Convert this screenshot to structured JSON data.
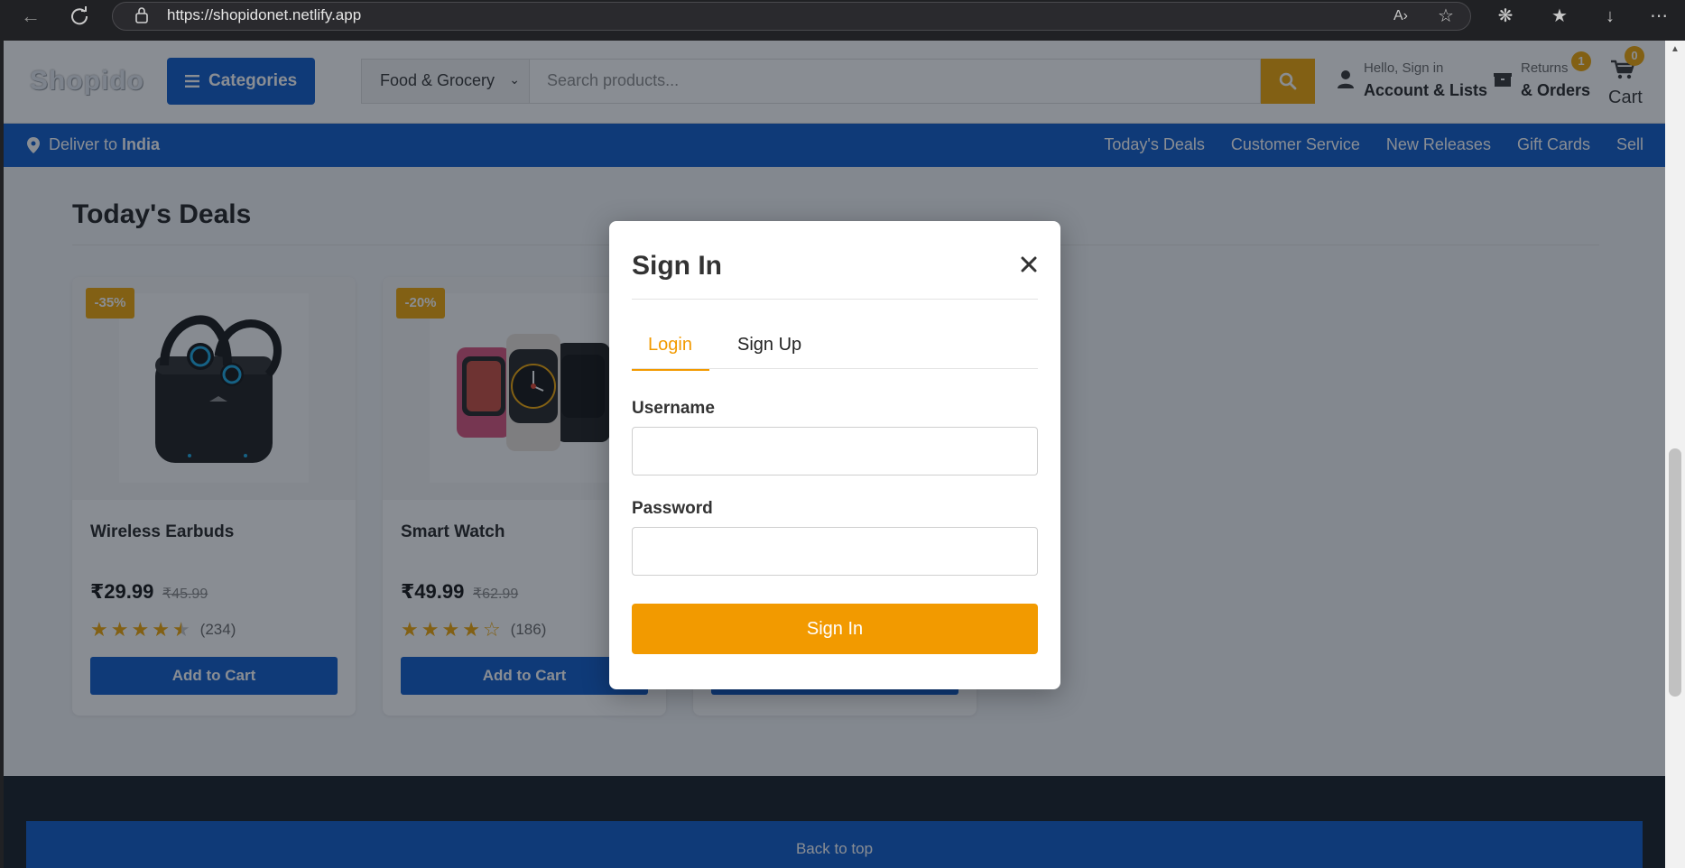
{
  "browser": {
    "url": "https://shopidonet.netlify.app"
  },
  "header": {
    "logo": "Shopido",
    "categories_label": "Categories",
    "search_category": "Food & Grocery",
    "search_placeholder": "Search products...",
    "account_small": "Hello, Sign in",
    "account_big": "Account & Lists",
    "returns_small": "Returns",
    "returns_big": "& Orders",
    "returns_badge": "1",
    "cart_label": "Cart",
    "cart_count": "0"
  },
  "subnav": {
    "deliver_prefix": "Deliver to",
    "deliver_country": "India",
    "links": [
      "Today's Deals",
      "Customer Service",
      "New Releases",
      "Gift Cards",
      "Sell"
    ]
  },
  "deals": {
    "title": "Today's Deals",
    "products": [
      {
        "name": "Wireless Earbuds",
        "discount": "-35%",
        "price": "₹29.99",
        "old_price": "₹45.99",
        "rating": 4.5,
        "reviews": "(234)",
        "button": "Add to Cart"
      },
      {
        "name": "Smart Watch",
        "discount": "-20%",
        "price": "₹49.99",
        "old_price": "₹62.99",
        "rating": 4,
        "reviews": "(186)",
        "button": "Add to Cart"
      }
    ]
  },
  "footer": {
    "back_to_top": "Back to top"
  },
  "modal": {
    "title": "Sign In",
    "tabs": [
      "Login",
      "Sign Up"
    ],
    "active_tab": "Login",
    "username_label": "Username",
    "username_value": "",
    "password_label": "Password",
    "password_value": "",
    "submit_label": "Sign In"
  },
  "colors": {
    "brand_blue": "#0a58c9",
    "accent_orange": "#f0a500",
    "modal_accent": "#f29a00"
  }
}
